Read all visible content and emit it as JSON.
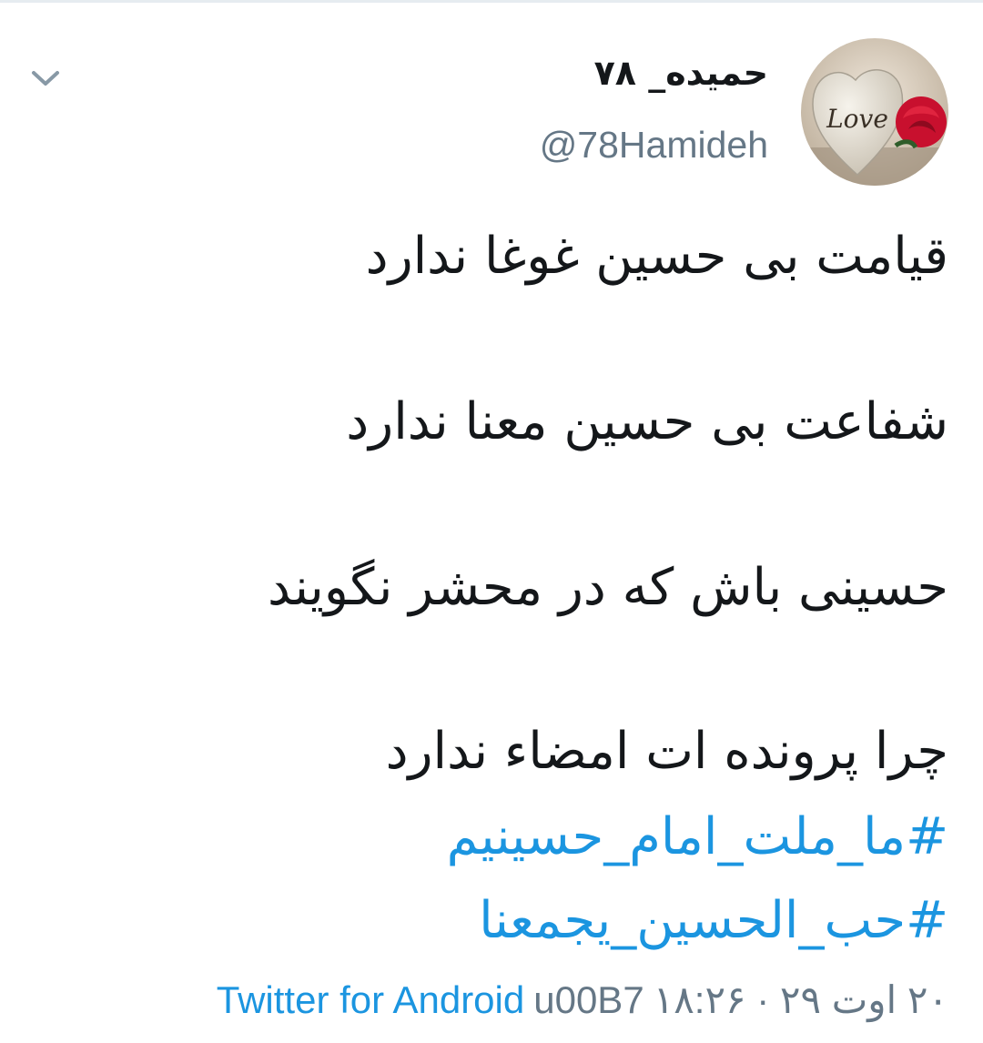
{
  "tweet": {
    "display_name": "حمیده_ ۷۸",
    "handle": "@78Hamideh",
    "lines": [
      "قیامت بی حسین غوغا ندارد",
      "شفاعت بی حسین معنا ندارد",
      "حسینی باش که در محشر نگویند",
      "چرا پرونده ات امضاء ندارد"
    ],
    "hashtags": [
      "#ما_ملت_امام_حسینیم",
      "#حب_الحسین_یجمعنا"
    ],
    "source": "Twitter for Android",
    "separator": "u00B7",
    "date": "۲۰ اوت ۲۹ · ۱۸:۲۶",
    "avatar_text": "Love"
  },
  "icons": {
    "menu": "chevron-down-icon"
  },
  "colors": {
    "link": "#1b95e0",
    "secondary": "#657786",
    "text": "#14171a"
  }
}
